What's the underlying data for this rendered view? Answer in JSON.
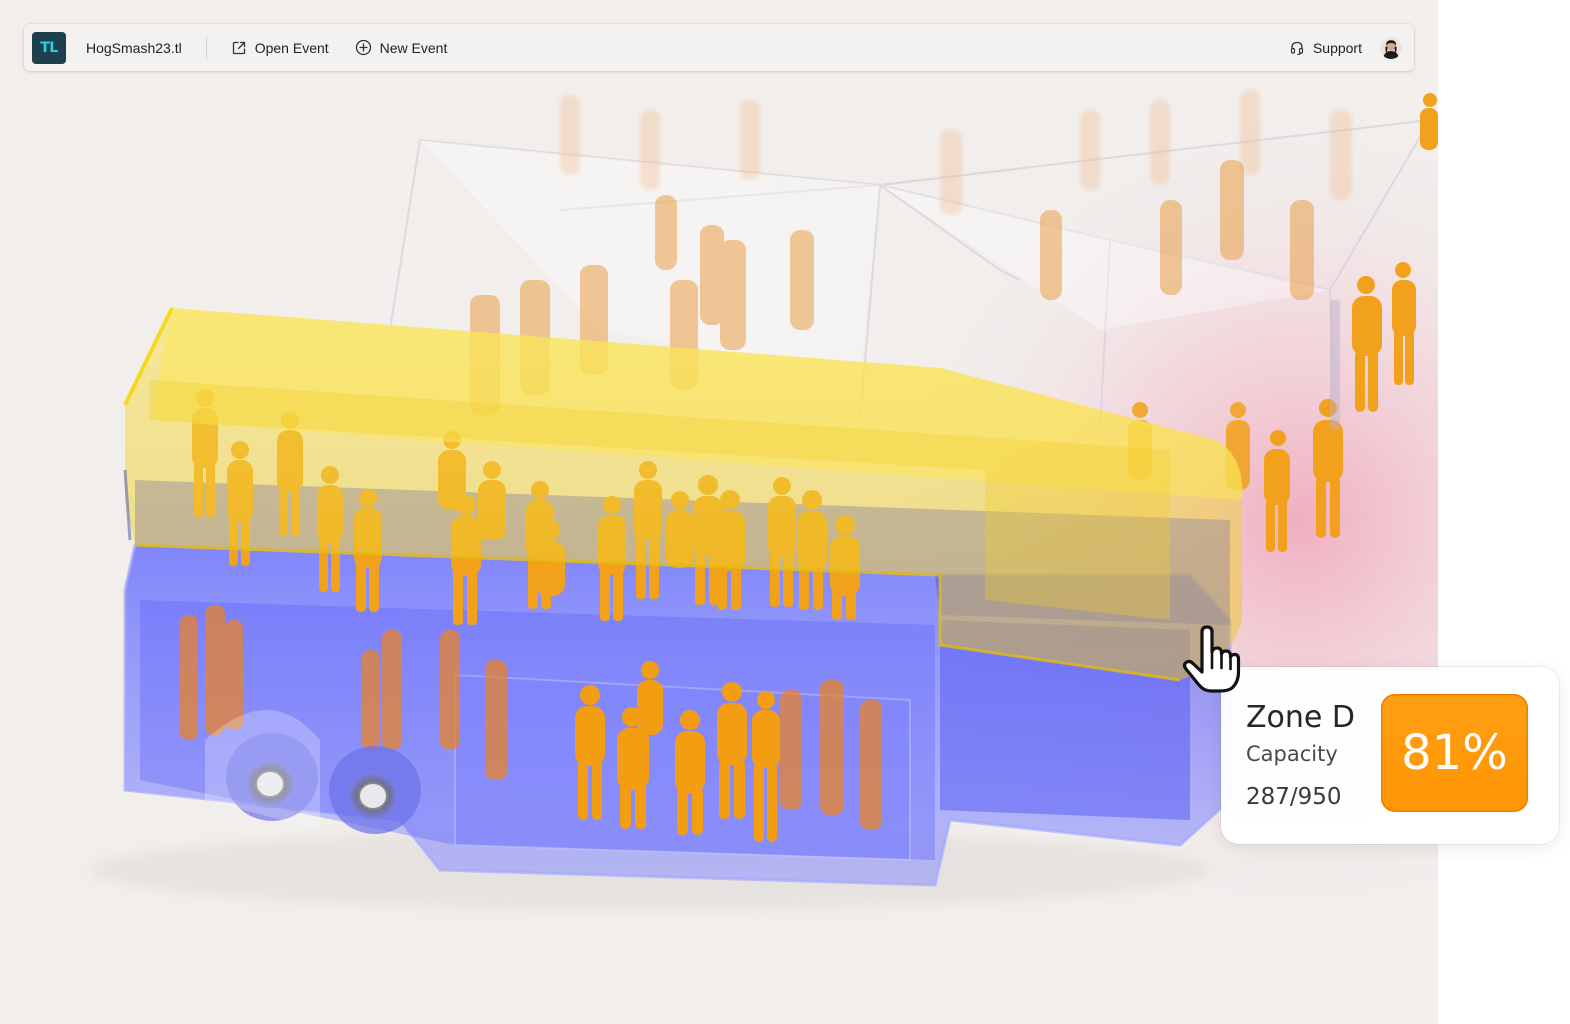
{
  "toolbar": {
    "logo_text": "TL",
    "file_name": "HogSmash23.tl",
    "open_event_label": "Open Event",
    "new_event_label": "New Event",
    "support_label": "Support"
  },
  "icons": {
    "open_event": "external-link-icon",
    "new_event": "plus-circle-icon",
    "support": "headset-icon",
    "avatar": "user-avatar",
    "cursor": "pointer-hand-icon"
  },
  "zone_card": {
    "title": "Zone D",
    "capacity_label": "Capacity",
    "count": "287/950",
    "percent_label": "81%",
    "occupancy": 0.81
  },
  "colors": {
    "logo_bg": "#1d3f4e",
    "logo_text": "#28d3de",
    "badge": "#ff9a0a",
    "zone_lower": "#4f55ff",
    "zone_upper": "#f5d42a",
    "people": "#f2a020"
  }
}
